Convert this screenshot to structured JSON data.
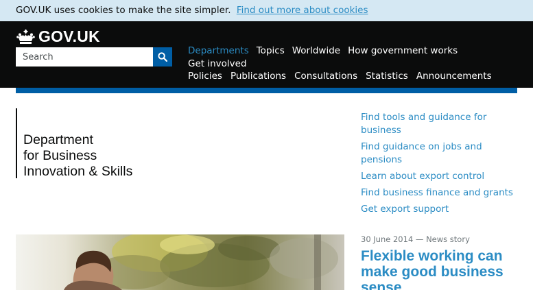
{
  "cookie_banner": {
    "text": "GOV.UK uses cookies to make the site simpler.",
    "link_text": "Find out more about cookies"
  },
  "header": {
    "logo_text": "GOV.UK",
    "logo_icon": "crown-icon",
    "search": {
      "placeholder": "Search",
      "button_icon": "search-icon"
    },
    "nav_primary": [
      {
        "label": "Departments",
        "active": true
      },
      {
        "label": "Topics"
      },
      {
        "label": "Worldwide"
      },
      {
        "label": "How government works"
      },
      {
        "label": "Get involved"
      }
    ],
    "nav_secondary": [
      {
        "label": "Policies"
      },
      {
        "label": "Publications"
      },
      {
        "label": "Consultations"
      },
      {
        "label": "Statistics"
      },
      {
        "label": "Announcements"
      }
    ]
  },
  "organisation": {
    "name_lines": [
      "Department",
      "for Business",
      "Innovation & Skills"
    ]
  },
  "quick_links": [
    "Find tools and guidance for business",
    "Find guidance on jobs and pensions",
    "Learn about export control",
    "Find business finance and grants",
    "Get export support"
  ],
  "news": {
    "date": "30 June 2014",
    "type": "News story",
    "title": "Flexible working can make good business sense"
  },
  "colors": {
    "header_bg": "#0b0c0c",
    "cookie_bg": "#d5e8f3",
    "link": "#2b8cc4",
    "brand_blue": "#005ea5"
  }
}
